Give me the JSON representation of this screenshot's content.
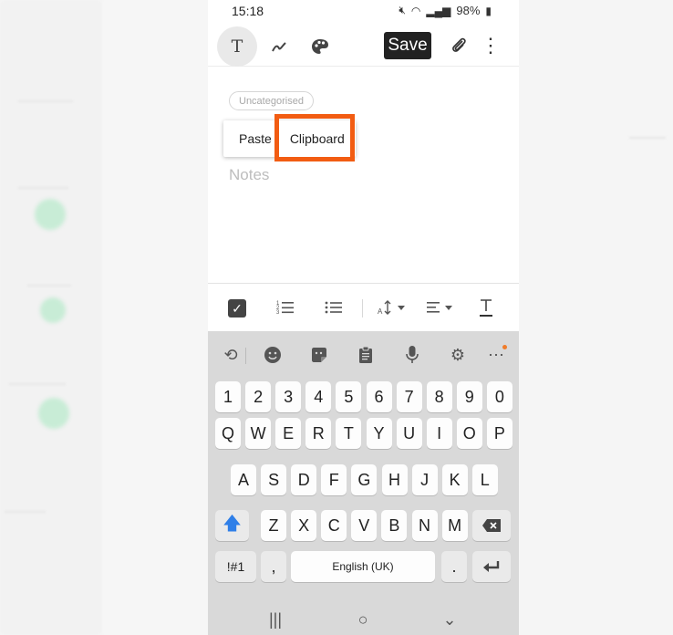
{
  "status": {
    "time": "15:18",
    "battery": "98%"
  },
  "toolbar": {
    "text_tool": "T",
    "save_label": "Save"
  },
  "note": {
    "category": "Uncategorised",
    "placeholder": "Notes"
  },
  "popup": {
    "paste": "Paste",
    "clipboard": "Clipboard"
  },
  "highlight_color": "#f25c12",
  "format_bar": {
    "icons": [
      "checkbox-icon",
      "numbered-list-icon",
      "bullet-list-icon",
      "text-size-icon",
      "align-icon",
      "text-style-icon"
    ]
  },
  "keyboard": {
    "tools": [
      "translate-icon",
      "emoji-icon",
      "sticker-icon",
      "clipboard-icon",
      "mic-icon",
      "settings-icon",
      "more-icon"
    ],
    "row_numbers": [
      "1",
      "2",
      "3",
      "4",
      "5",
      "6",
      "7",
      "8",
      "9",
      "0"
    ],
    "row1": [
      "Q",
      "W",
      "E",
      "R",
      "T",
      "Y",
      "U",
      "I",
      "O",
      "P"
    ],
    "row2": [
      "A",
      "S",
      "D",
      "F",
      "G",
      "H",
      "J",
      "K",
      "L"
    ],
    "row3": [
      "Z",
      "X",
      "C",
      "V",
      "B",
      "N",
      "M"
    ],
    "symbols_key": "!#1",
    "comma": ",",
    "space_label": "English (UK)",
    "period": "."
  },
  "nav": {
    "recents": "|||",
    "home": "○",
    "back": "⌄"
  }
}
